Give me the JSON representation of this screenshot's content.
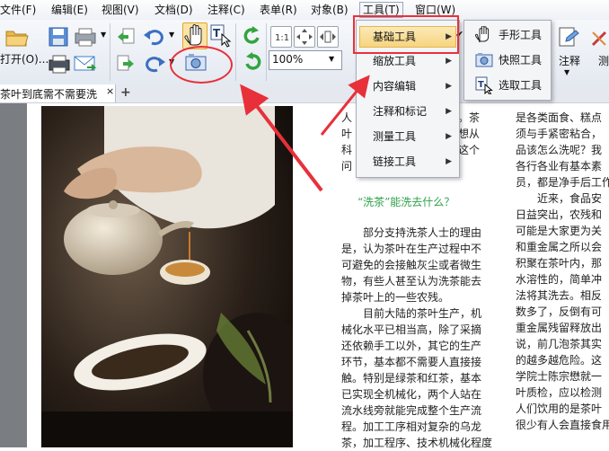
{
  "menubar": {
    "items": [
      "文件(F)",
      "编辑(E)",
      "视图(V)",
      "文档(D)",
      "注释(C)",
      "表单(R)",
      "对象(B)",
      "工具(T)",
      "窗口(W)"
    ]
  },
  "toolbar": {
    "open_label": "打开(O)...",
    "zoom_value": "100%",
    "annotate_label": "注释",
    "measure_label": "测"
  },
  "tabs": {
    "doc_title": "茶叶到底需不需要洗",
    "close": "×",
    "new_tab": "+"
  },
  "tools_menu": {
    "items": [
      {
        "label": "基础工具",
        "highlighted": true
      },
      {
        "label": "缩放工具"
      },
      {
        "label": "内容编辑"
      },
      {
        "label": "注释和标记"
      },
      {
        "label": "测量工具"
      },
      {
        "label": "链接工具"
      }
    ],
    "arrow": "▶"
  },
  "sub_menu": {
    "items": [
      {
        "label": "手形工具",
        "icon": "hand-icon",
        "checked": true
      },
      {
        "label": "快照工具",
        "icon": "camera-icon"
      },
      {
        "label": "选取工具",
        "icon": "select-text-icon"
      }
    ],
    "check": "✔"
  },
  "article": {
    "col1_top": [
      "人",
      "叶",
      "科",
      "问"
    ],
    "col1_top_suffix": [
      "。茶",
      "度想从",
      "在这个",
      ""
    ],
    "heading": "“洗茶”能洗去什么？",
    "col1": [
      "　　部分支持洗茶人士的理由",
      "是，认为茶叶在生产过程中不",
      "可避免的会接触灰尘或者微生",
      "物，有些人甚至认为洗茶能去",
      "掉茶叶上的一些农残。",
      "　　目前大陆的茶叶生产，机",
      "械化水平已相当高，除了采摘",
      "还依赖手工以外，其它的生产",
      "环节，基本都不需要人直接接",
      "触。特别是绿茶和红茶，基本",
      "已实现全机械化，两个人站在",
      "流水线旁就能完成整个生产流",
      "程。加工工序相对复杂的乌龙",
      "茶，加工程序、技术机械化程度"
    ],
    "col2": [
      "是各类面食、糕点",
      "须与手紧密粘合，",
      "品该怎么洗呢？我",
      "各行各业有基本素",
      "员，都是净手后工作",
      "　　近来，食品安",
      "日益突出，农残和",
      "可能是大家更为关",
      "和重金属之所以会",
      "积聚在茶叶内，那",
      "水溶性的，简单冲",
      "法将其洗去。相反",
      "数多了，反倒有可",
      "重金属残留释放出",
      "说，前几泡茶其实",
      "的越多越危险。这",
      "学院士陈宗懋就一",
      "叶质检，应以检测",
      "人们饮用的是茶叶",
      "很少有人会直接食用",
      "　　"
    ]
  }
}
